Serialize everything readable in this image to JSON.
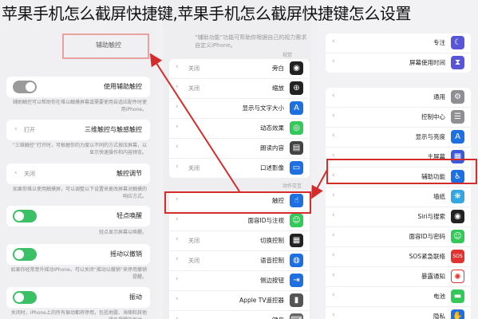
{
  "title": "苹果手机怎么截屏快捷键,苹果手机怎么截屏快捷键怎么设置",
  "colors": {
    "highlight": "#d62b2b",
    "toggle_on": "#3cc065",
    "toggle_off": "#9a9a9a"
  },
  "left": {
    "header": "辅助触控",
    "rows": [
      {
        "label": "使用辅助触控",
        "control": "toggle-off"
      },
      {
        "label": "三维触控与触感触控",
        "value": "打开",
        "control": "chevron"
      },
      {
        "label": "触控调节",
        "value": "关闭",
        "control": "chevron"
      },
      {
        "label": "轻点唤醒",
        "control": "toggle-on"
      },
      {
        "label": "摇动以撤销",
        "control": "toggle-on"
      },
      {
        "label": "振动",
        "control": "toggle-on"
      }
    ],
    "descriptions": [
      "辅助触控可以帮助你在难以触摸屏幕或需要使用自适应配件时使用iPhone。",
      "“三维触控”打开时，可根据你的力度以不同的方式按压屏幕，以显示快速操作和内容预览。",
      "如果你难以使用触摸屏，可以调整以下设置来更改屏幕对触摸的响应方式。",
      "轻点显示屏幕以唤醒。",
      "如果你经常意外摇动iPhone，可以关闭“摇动以撤销”来停用撤销提醒。",
      "关闭时，iPhone上的所有振动都将停用，包括地震、海啸和其他紧急提醒的振动。"
    ]
  },
  "middle": {
    "header": "“辅助功能”功能可帮助你根据自己的视力需求自定义iPhone。",
    "section_vision": "视觉",
    "section_interaction": "动作交互",
    "vision_rows": [
      {
        "label": "旁白",
        "value": "关闭",
        "icon": "voiceover-icon",
        "color": "#222222"
      },
      {
        "label": "缩放",
        "value": "关闭",
        "icon": "zoom-icon",
        "color": "#222222"
      },
      {
        "label": "显示与文字大小",
        "value": "",
        "icon": "text-size-icon",
        "color": "#1e6fe0"
      },
      {
        "label": "动态效果",
        "value": "",
        "icon": "motion-icon",
        "color": "#34c759"
      },
      {
        "label": "朗读内容",
        "value": "",
        "icon": "speech-icon",
        "color": "#444444"
      },
      {
        "label": "口述影像",
        "value": "关闭",
        "icon": "audio-description-icon",
        "color": "#1e6fe0"
      }
    ],
    "interaction_rows": [
      {
        "label": "触控",
        "value": "",
        "icon": "touch-icon",
        "color": "#1e6fe0"
      },
      {
        "label": "面容ID与注视",
        "value": "",
        "icon": "faceid-icon",
        "color": "#34c759"
      },
      {
        "label": "切换控制",
        "value": "关闭",
        "icon": "switch-control-icon",
        "color": "#222222"
      },
      {
        "label": "语音控制",
        "value": "关闭",
        "icon": "voice-control-icon",
        "color": "#1e6fe0"
      },
      {
        "label": "侧边按钮",
        "value": "",
        "icon": "side-button-icon",
        "color": "#1e6fe0"
      },
      {
        "label": "Apple TV遥控器",
        "value": "",
        "icon": "remote-icon",
        "color": "#555555"
      },
      {
        "label": "键盘",
        "value": "",
        "icon": "keyboard-icon",
        "color": "#666666"
      }
    ]
  },
  "right": {
    "top_rows": [
      {
        "label": "专注",
        "icon": "focus-icon",
        "color": "#5856d6"
      },
      {
        "label": "屏幕使用时间",
        "icon": "screen-time-icon",
        "color": "#5856d6"
      }
    ],
    "rows": [
      {
        "label": "通用",
        "icon": "gear-icon",
        "color": "#8e8e93"
      },
      {
        "label": "控制中心",
        "icon": "control-center-icon",
        "color": "#8e8e93"
      },
      {
        "label": "显示与亮度",
        "icon": "display-icon",
        "color": "#1e6fe0"
      },
      {
        "label": "主屏幕",
        "icon": "home-screen-icon",
        "color": "#3a5ad9"
      },
      {
        "label": "辅助功能",
        "icon": "accessibility-icon",
        "color": "#1e6fe0"
      },
      {
        "label": "墙纸",
        "icon": "wallpaper-icon",
        "color": "#36a6e0"
      },
      {
        "label": "Siri与搜索",
        "icon": "siri-icon",
        "color": "#222222"
      },
      {
        "label": "面容ID与密码",
        "icon": "faceid-icon",
        "color": "#34c759"
      },
      {
        "label": "SOS紧急联络",
        "icon": "sos-icon",
        "color": "#e0332f"
      },
      {
        "label": "暴露通知",
        "icon": "exposure-icon",
        "color": "#e0332f"
      },
      {
        "label": "电池",
        "icon": "battery-icon",
        "color": "#34c759"
      },
      {
        "label": "隐私",
        "icon": "privacy-icon",
        "color": "#1e6fe0"
      }
    ]
  }
}
